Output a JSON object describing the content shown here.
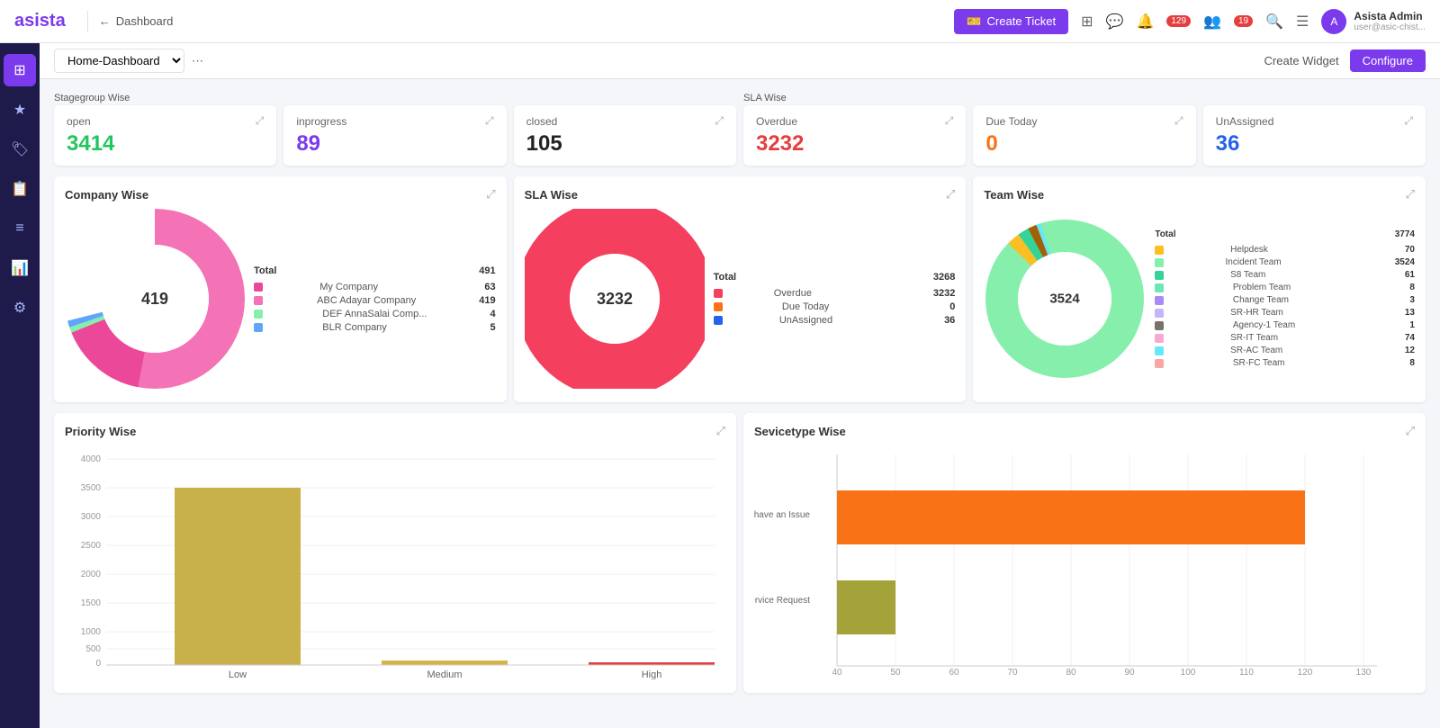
{
  "app": {
    "logo": "asista",
    "logo_star": "★"
  },
  "topnav": {
    "breadcrumb_back": "←",
    "breadcrumb_text": "Dashboard",
    "create_ticket": "Create Ticket",
    "notifications_count": "129",
    "agents_count": "19",
    "user_name": "Asista Admin",
    "user_email": "user@asic-chist..."
  },
  "subnav": {
    "dashboard_select": "Home-Dashboard",
    "more_icon": "⋯",
    "create_widget": "Create Widget",
    "configure": "Configure"
  },
  "stagegroup_label": "Stagegroup Wise",
  "sla_label": "SLA Wise",
  "stat_cards": [
    {
      "title": "open",
      "value": "3414",
      "color": "green"
    },
    {
      "title": "inprogress",
      "value": "89",
      "color": "purple"
    },
    {
      "title": "closed",
      "value": "105",
      "color": "black"
    },
    {
      "title": "Overdue",
      "value": "3232",
      "color": "red",
      "sla": true
    },
    {
      "title": "Due Today",
      "value": "0",
      "color": "orange",
      "sla": true
    },
    {
      "title": "UnAssigned",
      "value": "36",
      "color": "blue",
      "sla": true
    }
  ],
  "company_wise": {
    "title": "Company Wise",
    "total": "491",
    "total_label": "Total",
    "donut_label": "419",
    "segments": [
      {
        "label": "My Company",
        "value": 63,
        "color": "#ec4899"
      },
      {
        "label": "ABC Adayar Company",
        "value": 419,
        "color": "#f472b6"
      },
      {
        "label": "DEF AnnaSalai Comp...",
        "value": 4,
        "color": "#86efac"
      },
      {
        "label": "BLR Company",
        "value": 5,
        "color": "#60a5fa"
      }
    ]
  },
  "sla_wise": {
    "title": "SLA Wise",
    "total": "3268",
    "total_label": "Total",
    "donut_label": "3232",
    "segments": [
      {
        "label": "Overdue",
        "value": 3232,
        "color": "#f43f5e"
      },
      {
        "label": "Due Today",
        "value": 0,
        "color": "#f97316"
      },
      {
        "label": "UnAssigned",
        "value": 36,
        "color": "#2563eb"
      }
    ]
  },
  "team_wise": {
    "title": "Team Wise",
    "total": "3774",
    "total_label": "Total",
    "donut_label": "3524",
    "segments": [
      {
        "label": "Helpdesk",
        "value": 70,
        "color": "#fbbf24"
      },
      {
        "label": "Incident Team",
        "value": 3524,
        "color": "#86efac"
      },
      {
        "label": "S8 Team",
        "value": 61,
        "color": "#34d399"
      },
      {
        "label": "Problem Team",
        "value": 8,
        "color": "#6ee7b7"
      },
      {
        "label": "Change Team",
        "value": 3,
        "color": "#a78bfa"
      },
      {
        "label": "SR-HR Team",
        "value": 13,
        "color": "#c4b5fd"
      },
      {
        "label": "Agency-1 Team",
        "value": 1,
        "color": "#78716c"
      },
      {
        "label": "SR-IT Team",
        "value": 74,
        "color": "#f9a8d4"
      },
      {
        "label": "SR-AC Team",
        "value": 12,
        "color": "#67e8f9"
      },
      {
        "label": "SR-FC Team",
        "value": 8,
        "color": "#fca5a5"
      }
    ]
  },
  "priority_wise": {
    "title": "Priority Wise",
    "bars": [
      {
        "label": "Low",
        "value": 3500,
        "color": "#c8b04a",
        "max": 4000
      },
      {
        "label": "Medium",
        "value": 120,
        "color": "#d4b44a",
        "max": 4000
      },
      {
        "label": "High",
        "value": 80,
        "color": "#e53e3e",
        "max": 4000
      }
    ],
    "y_labels": [
      "4000",
      "3500",
      "3000",
      "2500",
      "2000",
      "1500",
      "1000",
      "500",
      "0"
    ]
  },
  "servicetype_wise": {
    "title": "Sevicetype Wise",
    "bars": [
      {
        "label": "I have an Issue",
        "value": 120,
        "color": "#f97316",
        "max": 130
      },
      {
        "label": "I have an Service Request",
        "value": 50,
        "color": "#a3a339",
        "max": 130
      }
    ],
    "x_labels": [
      "40",
      "50",
      "60",
      "70",
      "80",
      "90",
      "100",
      "110",
      "120",
      "130"
    ]
  }
}
